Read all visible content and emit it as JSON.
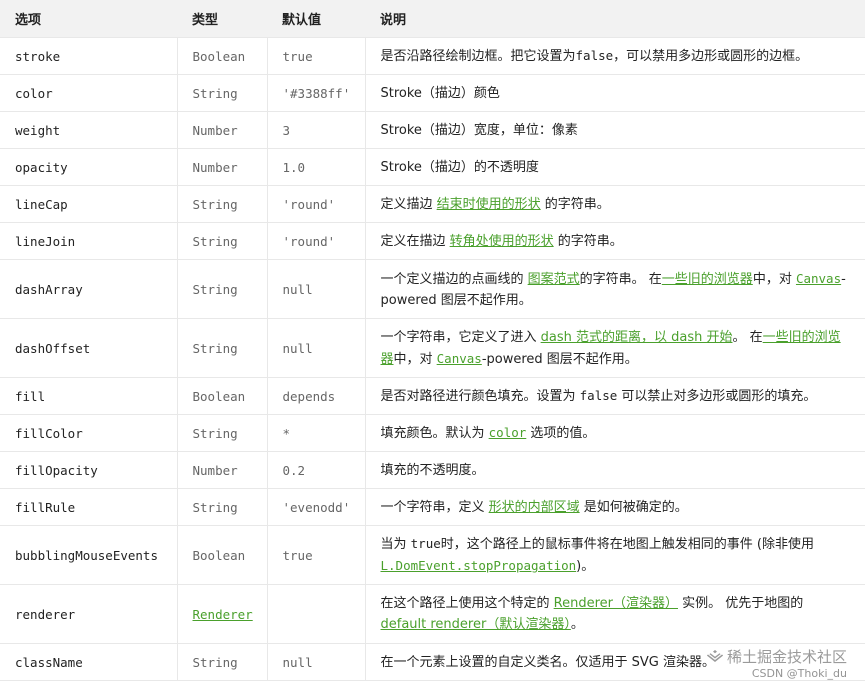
{
  "headers": {
    "option": "选项",
    "type": "类型",
    "default": "默认值",
    "description": "说明"
  },
  "rows": [
    {
      "option": "stroke",
      "type": "Boolean",
      "default": "true",
      "desc": [
        {
          "t": "是否沿路径绘制边框。把它设置为"
        },
        {
          "t": "false",
          "k": "code"
        },
        {
          "t": "，可以禁用多边形或圆形的边框。"
        }
      ]
    },
    {
      "option": "color",
      "type": "String",
      "default": "'#3388ff'",
      "desc": [
        {
          "t": "Stroke（描边）颜色"
        }
      ]
    },
    {
      "option": "weight",
      "type": "Number",
      "default": "3",
      "desc": [
        {
          "t": "Stroke（描边）宽度，单位：像素"
        }
      ]
    },
    {
      "option": "opacity",
      "type": "Number",
      "default": "1.0",
      "desc": [
        {
          "t": "Stroke（描边）的不透明度"
        }
      ]
    },
    {
      "option": "lineCap",
      "type": "String",
      "default": "'round'",
      "desc": [
        {
          "t": "定义描边 "
        },
        {
          "t": "结束时使用的形状",
          "k": "link"
        },
        {
          "t": " 的字符串。"
        }
      ]
    },
    {
      "option": "lineJoin",
      "type": "String",
      "default": "'round'",
      "desc": [
        {
          "t": "定义在描边 "
        },
        {
          "t": "转角处使用的形状",
          "k": "link"
        },
        {
          "t": " 的字符串。"
        }
      ]
    },
    {
      "option": "dashArray",
      "type": "String",
      "default": "null",
      "desc": [
        {
          "t": "一个定义描边的点画线的 "
        },
        {
          "t": "图案范式",
          "k": "link"
        },
        {
          "t": "的字符串。 在"
        },
        {
          "t": "一些旧的浏览器",
          "k": "link"
        },
        {
          "t": "中，对 "
        },
        {
          "t": "Canvas",
          "k": "linkcode"
        },
        {
          "t": "-powered 图层不起作用。"
        }
      ]
    },
    {
      "option": "dashOffset",
      "type": "String",
      "default": "null",
      "desc": [
        {
          "t": "一个字符串，它定义了进入 "
        },
        {
          "t": "dash 范式的距离，以 dash 开始",
          "k": "link"
        },
        {
          "t": "。 在"
        },
        {
          "t": "一些旧的浏览器",
          "k": "link"
        },
        {
          "t": "中，对 "
        },
        {
          "t": "Canvas",
          "k": "linkcode"
        },
        {
          "t": "-powered 图层不起作用。"
        }
      ]
    },
    {
      "option": "fill",
      "type": "Boolean",
      "default": "depends",
      "desc": [
        {
          "t": "是否对路径进行颜色填充。设置为 "
        },
        {
          "t": "false",
          "k": "code"
        },
        {
          "t": " 可以禁止对多边形或圆形的填充。"
        }
      ]
    },
    {
      "option": "fillColor",
      "type": "String",
      "default": "*",
      "desc": [
        {
          "t": "填充颜色。默认为 "
        },
        {
          "t": "color",
          "k": "linkcode"
        },
        {
          "t": " 选项的值。"
        }
      ]
    },
    {
      "option": "fillOpacity",
      "type": "Number",
      "default": "0.2",
      "desc": [
        {
          "t": "填充的不透明度。"
        }
      ]
    },
    {
      "option": "fillRule",
      "type": "String",
      "default": "'evenodd'",
      "desc": [
        {
          "t": "一个字符串，定义 "
        },
        {
          "t": "形状的内部区域",
          "k": "link"
        },
        {
          "t": " 是如何被确定的。"
        }
      ]
    },
    {
      "option": "bubblingMouseEvents",
      "type": "Boolean",
      "default": "true",
      "desc": [
        {
          "t": "当为 "
        },
        {
          "t": "true",
          "k": "code"
        },
        {
          "t": "时，这个路径上的鼠标事件将在地图上触发相同的事件 (除非使用 "
        },
        {
          "t": "L.DomEvent.stopPropagation",
          "k": "linkcode"
        },
        {
          "t": ")。"
        }
      ]
    },
    {
      "option": "renderer",
      "type": "Renderer",
      "type_is_link": true,
      "default": "",
      "desc": [
        {
          "t": "在这个路径上使用这个特定的 "
        },
        {
          "t": "Renderer（渲染器）",
          "k": "link"
        },
        {
          "t": " 实例。 优先于地图的 "
        },
        {
          "t": "default renderer（默认渲染器）",
          "k": "link"
        },
        {
          "t": "。"
        }
      ]
    },
    {
      "option": "className",
      "type": "String",
      "default": "null",
      "desc": [
        {
          "t": "在一个元素上设置的自定义类名。仅适用于 SVG 渲染器。"
        }
      ]
    }
  ],
  "row_heights": [],
  "watermark": {
    "main": "稀土掘金技术社区",
    "sub": "CSDN @Thoki_du"
  }
}
